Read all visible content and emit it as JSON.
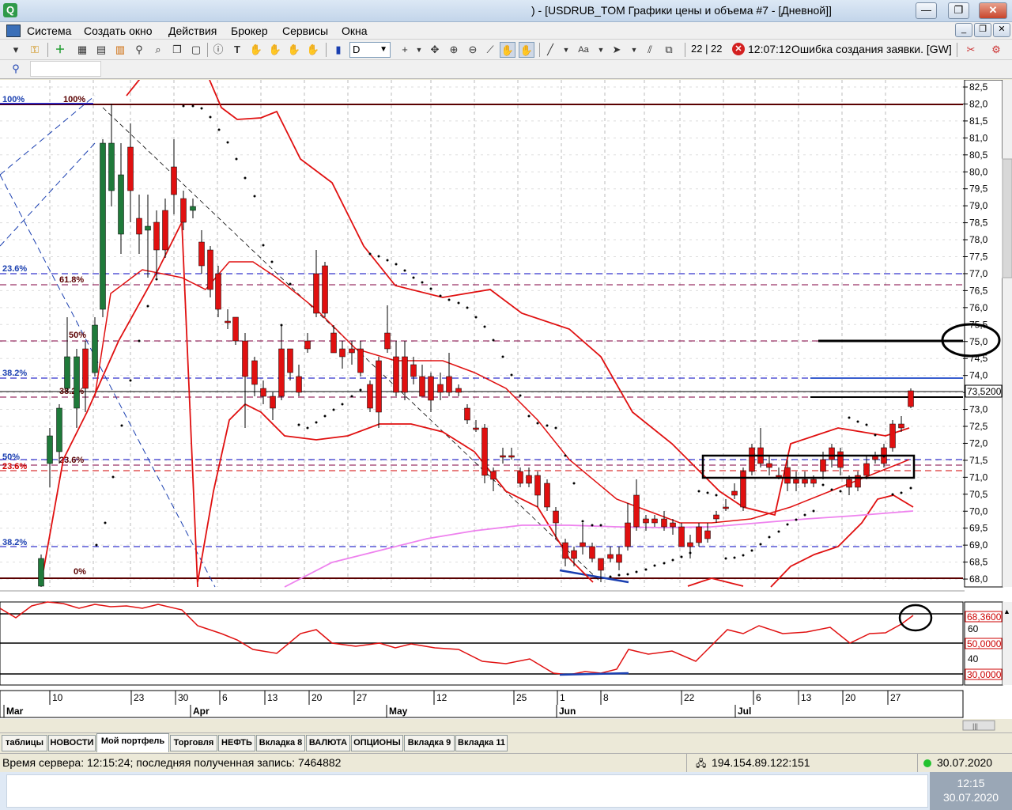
{
  "window": {
    "title": ") - [USDRUB_TOM Графики цены и объема #7 - [Дневной]]",
    "app_icon": "Q",
    "minimize_label": "—",
    "maximize_label": "❐",
    "close_label": "✕"
  },
  "menu": {
    "items": [
      "Система",
      "Создать окно",
      "Действия",
      "Брокер",
      "Сервисы",
      "Окна"
    ]
  },
  "toolbar": {
    "interval_value": "D",
    "counter": "22 | 22",
    "error_time": "12:07:12",
    "error_text": "Ошибка создания заявки. [GW]"
  },
  "price_axis": {
    "labels": [
      "82,5",
      "82,0",
      "81,5",
      "81,0",
      "80,5",
      "80,0",
      "79,5",
      "79,0",
      "78,5",
      "78,0",
      "77,5",
      "77,0",
      "76,5",
      "76,0",
      "75,5",
      "75,0",
      "74,5",
      "74,0",
      "73,5",
      "73,0",
      "72,5",
      "72,0",
      "71,5",
      "71,0",
      "70,5",
      "70,0",
      "69,5",
      "69,0",
      "68,5",
      "68,0"
    ],
    "last_price": "73,5200"
  },
  "fib_labels": {
    "left_100": "100%",
    "top_100": "100%",
    "a_23_6": "23.6%",
    "b_61_8": "61.8%",
    "c_50": "50%",
    "d_38_2": "38.2%",
    "e_38_2": "38.2%",
    "f_50": "50%",
    "g_23_6": "23.6%",
    "h_23_6": "23.6%",
    "i_38_2": "38.2%",
    "j_0": "0%"
  },
  "oscillator_axis": {
    "labels": [
      "60",
      "40"
    ],
    "current": "68,3600",
    "level_50": "50,0000",
    "level_30": "30,0000"
  },
  "time_axis": {
    "days": [
      "10",
      "23",
      "30",
      "6",
      "13",
      "20",
      "27",
      "12",
      "25",
      "1",
      "8",
      "22",
      "6",
      "13",
      "20",
      "27"
    ],
    "months": [
      "Mar",
      "Apr",
      "May",
      "Jun",
      "Jul"
    ]
  },
  "tabs": [
    "таблицы",
    "НОВОСТИ",
    "Мой портфель",
    "Торговля",
    "НЕФТЬ",
    "Вкладка 8",
    "ВАЛЮТА",
    "ОПЦИОНЫ",
    "Вкладка 9",
    "Вкладка 11"
  ],
  "active_tab": "Мой портфель",
  "status": {
    "server_text": "Время сервера: 12:15:24; последняя полученная запись: 7464882",
    "connection": "194.154.89.122:151",
    "date": "30.07.2020"
  },
  "clock": {
    "time": "12:15",
    "date": "30.07.2020"
  },
  "colors": {
    "bull": "#1f7a3a",
    "bear": "#e01010",
    "bollinger": "#e01010",
    "ma_slow": "#ee82ee",
    "fib_lines": "#0000c0",
    "accent_error": "#d32020",
    "connection_ok": "#22c22e"
  }
}
